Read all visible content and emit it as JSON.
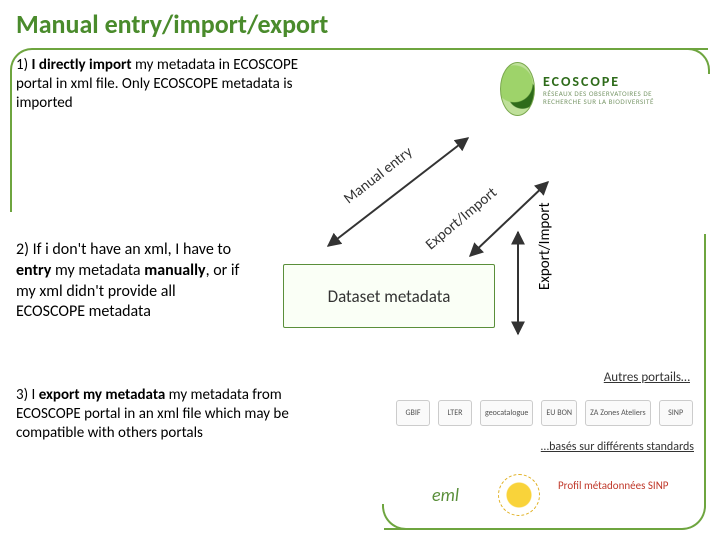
{
  "title": "Manual entry/import/export",
  "steps": {
    "s1_prefix": "1)  ",
    "s1_bold": "I directly import",
    "s1_rest": " my metadata in ECOSCOPE portal in xml file. Only ECOSCOPE metadata is imported",
    "s2_prefix": "2) If i don't have an xml, I have to ",
    "s2_bold": "entry",
    "s2_mid": " my metadata ",
    "s2_bold2": "manually",
    "s2_rest": ", or if my xml didn't provide all ECOSCOPE metadata",
    "s3_prefix": "3) I ",
    "s3_bold": "export my metadata",
    "s3_rest": " my metadata from ECOSCOPE portal in an xml file which may be compatible with others portals"
  },
  "arrows": {
    "manual_entry": "Manual entry",
    "export_import_diag": "Export/Import",
    "export_import_vert": "Export/Import"
  },
  "center_box": "Dataset metadata",
  "ecoscope": {
    "name": "ECOSCOPE",
    "tagline": "RÉSEAUX DES OBSERVATOIRES DE RECHERCHE SUR LA BIODIVERSITÉ"
  },
  "portals": {
    "title": "Autres portails…",
    "logos": [
      "GBIF",
      "LTER",
      "geocatalogue",
      "EU BON",
      "ZA Zones Ateliers",
      "SINP"
    ],
    "standards_line": "…basés sur différents standards",
    "eml": "eml",
    "profil": "Profil métadonnées SINP"
  }
}
